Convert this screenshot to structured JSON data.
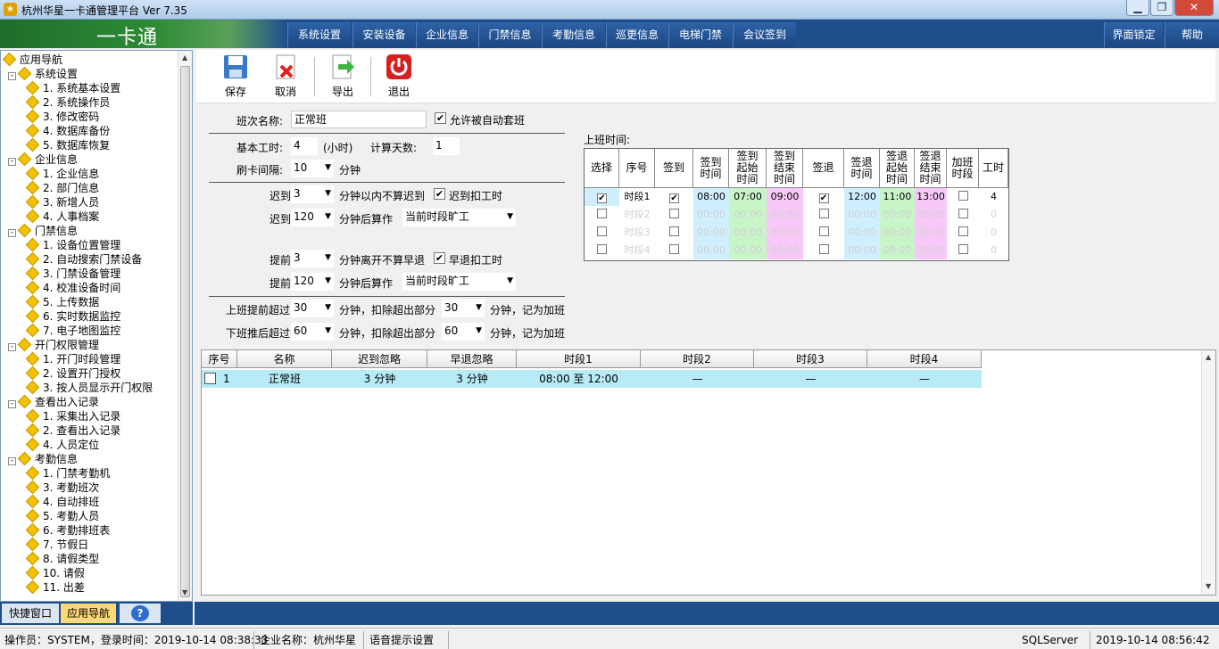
{
  "window": {
    "title": "杭州华星一卡通管理平台  Ver 7.35",
    "min": "▁",
    "max": "❐",
    "close": "✕"
  },
  "brand": "一卡通",
  "menu": [
    "系统设置",
    "安装设备",
    "企业信息",
    "门禁信息",
    "考勤信息",
    "巡更信息",
    "电梯门禁",
    "会议签到"
  ],
  "menu_right": [
    "界面锁定",
    "帮助"
  ],
  "sidebar": {
    "rows": [
      {
        "level": 0,
        "label": "应用导航"
      },
      {
        "level": 1,
        "label": "系统设置",
        "expand": "-"
      },
      {
        "level": 2,
        "label": "1.  系统基本设置"
      },
      {
        "level": 2,
        "label": "2.  系统操作员"
      },
      {
        "level": 2,
        "label": "3.  修改密码"
      },
      {
        "level": 2,
        "label": "4.  数据库备份"
      },
      {
        "level": 2,
        "label": "5.  数据库恢复"
      },
      {
        "level": 1,
        "label": "企业信息",
        "expand": "-"
      },
      {
        "level": 2,
        "label": "1.  企业信息"
      },
      {
        "level": 2,
        "label": "2.  部门信息"
      },
      {
        "level": 2,
        "label": "3.  新增人员"
      },
      {
        "level": 2,
        "label": "4.  人事档案"
      },
      {
        "level": 1,
        "label": "门禁信息",
        "expand": "-"
      },
      {
        "level": 2,
        "label": "1.  设备位置管理"
      },
      {
        "level": 2,
        "label": "2.  自动搜索门禁设备"
      },
      {
        "level": 2,
        "label": "3.  门禁设备管理"
      },
      {
        "level": 2,
        "label": "4.  校准设备时间"
      },
      {
        "level": 2,
        "label": "5.  上传数据"
      },
      {
        "level": 2,
        "label": "6.  实时数据监控"
      },
      {
        "level": 2,
        "label": "7.  电子地图监控"
      },
      {
        "level": 1,
        "label": "开门权限管理",
        "expand": "-"
      },
      {
        "level": 2,
        "label": "1.  开门时段管理"
      },
      {
        "level": 2,
        "label": "2.  设置开门授权"
      },
      {
        "level": 2,
        "label": "3.  按人员显示开门权限"
      },
      {
        "level": 1,
        "label": "查看出入记录",
        "expand": "-"
      },
      {
        "level": 2,
        "label": "1.  采集出入记录"
      },
      {
        "level": 2,
        "label": "2.  查看出入记录"
      },
      {
        "level": 2,
        "label": "4.  人员定位"
      },
      {
        "level": 1,
        "label": "考勤信息",
        "expand": "-"
      },
      {
        "level": 2,
        "label": "1.  门禁考勤机"
      },
      {
        "level": 2,
        "label": "3.  考勤班次"
      },
      {
        "level": 2,
        "label": "4.  自动排班"
      },
      {
        "level": 2,
        "label": "5.  考勤人员"
      },
      {
        "level": 2,
        "label": "6.  考勤排班表"
      },
      {
        "level": 2,
        "label": "7.  节假日"
      },
      {
        "level": 2,
        "label": "8.  请假类型"
      },
      {
        "level": 2,
        "label": "10.  请假"
      },
      {
        "level": 2,
        "label": "11.  出差"
      }
    ],
    "tabs": [
      "快捷窗口",
      "应用导航",
      "?"
    ]
  },
  "toolbar": {
    "save": "保存",
    "cancel": "取消",
    "export": "导出",
    "exit": "退出"
  },
  "form": {
    "shift_name_label": "班次名称:",
    "shift_name": "正常班",
    "allow_auto": "允许被自动套班",
    "base_hours_label": "基本工时:",
    "base_hours": "4",
    "hours_unit": "(小时)",
    "calc_days_label": "计算天数:",
    "calc_days": "1",
    "interval_label": "刷卡间隔:",
    "interval": "10",
    "minutes": "分钟",
    "late_label": "迟到",
    "late_val": "3",
    "late_text": "分钟以内不算迟到",
    "late_deduct": "迟到扣工时",
    "late2_val": "120",
    "after_count": "分钟后算作",
    "absent_opt": "当前时段旷工",
    "early_label": "提前",
    "early_val": "3",
    "early_text": "分钟离开不算早退",
    "early_deduct": "早退扣工时",
    "early2_val": "120",
    "ot_before_label": "上班提前超过",
    "ot_before": "30",
    "deduct_text": "分钟，扣除超出部分",
    "ot_before2": "30",
    "ot_suffix": "分钟，记为加班",
    "ot_after_label": "下班推后超过",
    "ot_after": "60",
    "ot_after2": "60"
  },
  "work_time": {
    "label": "上班时间:",
    "headers": [
      "选择",
      "序号",
      "签到",
      "签到\n时间",
      "签到\n起始\n时间",
      "签到\n结束\n时间",
      "签退",
      "签退\n时间",
      "签退\n起始\n时间",
      "签退\n结束\n时间",
      "加班\n时段",
      "工时"
    ],
    "rows": [
      {
        "sel": "✔",
        "no": "时段1",
        "in": "✔",
        "in_t": "08:00",
        "in_s": "07:00",
        "in_e": "09:00",
        "out": "✔",
        "out_t": "12:00",
        "out_s": "11:00",
        "out_e": "13:00",
        "ot": "",
        "hrs": "4"
      },
      {
        "sel": "",
        "no": "时段2",
        "in": "",
        "in_t": "00:00",
        "in_s": "00:00",
        "in_e": "00:00",
        "out": "",
        "out_t": "00:00",
        "out_s": "00:00",
        "out_e": "00:00",
        "ot": "",
        "hrs": "0"
      },
      {
        "sel": "",
        "no": "时段3",
        "in": "",
        "in_t": "00:00",
        "in_s": "00:00",
        "in_e": "00:00",
        "out": "",
        "out_t": "00:00",
        "out_s": "00:00",
        "out_e": "00:00",
        "ot": "",
        "hrs": "0"
      },
      {
        "sel": "",
        "no": "时段4",
        "in": "",
        "in_t": "00:00",
        "in_s": "00:00",
        "in_e": "00:00",
        "out": "",
        "out_t": "00:00",
        "out_s": "00:00",
        "out_e": "00:00",
        "ot": "",
        "hrs": "0"
      }
    ]
  },
  "shift_list": {
    "headers": [
      "序号",
      "名称",
      "迟到忽略",
      "早退忽略",
      "时段1",
      "时段2",
      "时段3",
      "时段4"
    ],
    "rows": [
      {
        "no": "1",
        "name": "正常班",
        "late": "3 分钟",
        "early": "3 分钟",
        "p1": "08:00 至 12:00",
        "p2": "—",
        "p3": "—",
        "p4": "—"
      }
    ]
  },
  "status": {
    "operator": "操作员：SYSTEM，登录时间：2019-10-14 08:38:33",
    "company": "企业名称：杭州华星",
    "voice": "语音提示设置",
    "db": "SQLServer",
    "time": "2019-10-14 08:56:42"
  },
  "colors": {
    "accent": "#1e4f8c",
    "blue_cell": "#cfefff",
    "green_cell": "#c8f5c8",
    "pink_cell": "#f8c8f8",
    "selected_row": "#b7ecf7"
  }
}
